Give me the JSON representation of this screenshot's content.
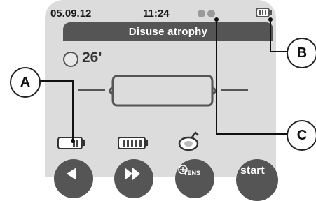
{
  "status": {
    "date": "05.09.12",
    "time": "11:24"
  },
  "title": "Disuse atrophy",
  "timer": {
    "value": "26'"
  },
  "buttons": {
    "tens_label": "TENS",
    "start_label": "start"
  },
  "callouts": {
    "a": "A",
    "b": "B",
    "c": "C"
  },
  "icons": {
    "battery_small": "battery-icon",
    "battery_large": "battery-icon",
    "electrode": "electrode-icon",
    "back": "back-icon",
    "forward": "forward-icon"
  }
}
